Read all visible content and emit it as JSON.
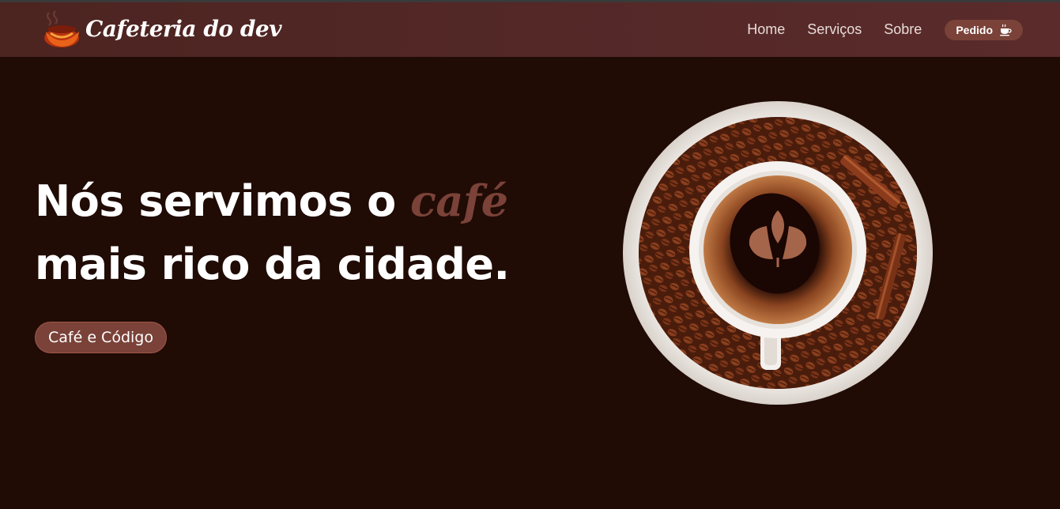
{
  "header": {
    "brand_name": "Cafeteria do dev",
    "logo_icon": "coffee-logo-icon",
    "nav": [
      "Home",
      "Serviços",
      "Sobre"
    ],
    "order_label": "Pedido",
    "order_icon": "coffee-cup-icon"
  },
  "hero": {
    "title_part1": "Nós servimos o ",
    "title_accent": "café",
    "title_part2": "mais rico da cidade.",
    "cta_label": "Café e Código",
    "image_icon": "coffee-cup-on-beans-image"
  },
  "colors": {
    "background": "#200b05",
    "header": "#532827",
    "accent": "#7a4238",
    "text": "#ffffff"
  }
}
